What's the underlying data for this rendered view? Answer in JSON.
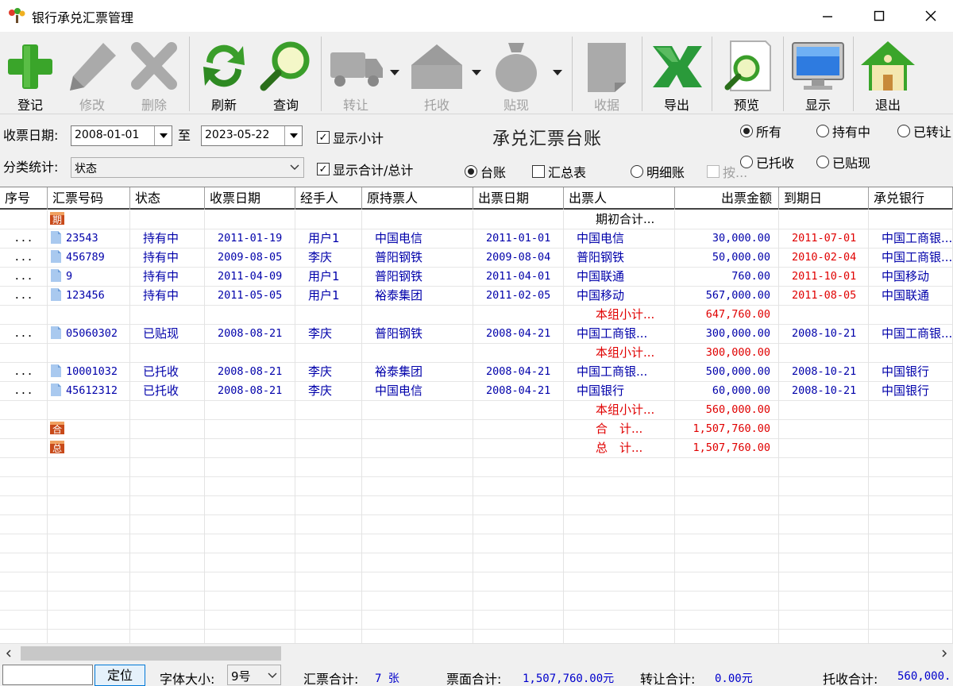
{
  "window": {
    "title": "银行承兑汇票管理"
  },
  "toolbar": {
    "items": [
      {
        "label": "登记",
        "icon": "plus-icon"
      },
      {
        "label": "修改",
        "icon": "pencil-icon"
      },
      {
        "label": "删除",
        "icon": "x-delete-icon"
      },
      {
        "label": "刷新",
        "icon": "refresh-icon"
      },
      {
        "label": "查询",
        "icon": "magnifier-icon"
      },
      {
        "label": "转让",
        "icon": "truck-icon"
      },
      {
        "label": "托收",
        "icon": "house-icon"
      },
      {
        "label": "贴现",
        "icon": "money-bag-icon"
      },
      {
        "label": "收据",
        "icon": "receipt-icon"
      },
      {
        "label": "导出",
        "icon": "excel-icon"
      },
      {
        "label": "预览",
        "icon": "preview-icon"
      },
      {
        "label": "显示",
        "icon": "monitor-icon"
      },
      {
        "label": "退出",
        "icon": "home-exit-icon"
      }
    ]
  },
  "filters": {
    "date_label": "收票日期:",
    "date_from": "2008-01-01",
    "date_to_label": "至",
    "date_to": "2023-05-22",
    "category_label": "分类统计:",
    "category_value": "状态",
    "show_subtotal": "显示小计",
    "show_total": "显示合计/总计",
    "report_title": "承兑汇票台账",
    "view_ledger": "台账",
    "view_summary": "汇总表",
    "view_detail": "明细账",
    "disabled_option": "按...",
    "status_all": "所有",
    "status_holding": "持有中",
    "status_transferred": "已转让",
    "status_collected": "已托收",
    "status_discounted": "已贴现"
  },
  "grid": {
    "columns": [
      "序号",
      "汇票号码",
      "状态",
      "收票日期",
      "经手人",
      "原持票人",
      "出票日期",
      "出票人",
      "出票金额",
      "到期日",
      "承兑银行"
    ],
    "opening_label": "期初合计...",
    "subtotal_label": "本组小计...",
    "total_label": "合　计...",
    "grand_label": "总　计...",
    "tag_opening": "期",
    "tag_total": "合",
    "tag_grand": "总",
    "rows": [
      {
        "kind": "opening"
      },
      {
        "kind": "data",
        "seq": "...",
        "no": "23543",
        "status": "持有中",
        "recv": "2011-01-19",
        "handler": "用户1",
        "holder": "中国电信",
        "issue": "2011-01-01",
        "drawer": "中国电信",
        "amount": "30,000.00",
        "due": "2011-07-01",
        "due_red": true,
        "bank": "中国工商银..."
      },
      {
        "kind": "data",
        "seq": "...",
        "no": "456789",
        "status": "持有中",
        "recv": "2009-08-05",
        "handler": "李庆",
        "holder": "普阳钢铁",
        "issue": "2009-08-04",
        "drawer": "普阳钢铁",
        "amount": "50,000.00",
        "due": "2010-02-04",
        "due_red": true,
        "bank": "中国工商银..."
      },
      {
        "kind": "data",
        "seq": "...",
        "no": "9",
        "status": "持有中",
        "recv": "2011-04-09",
        "handler": "用户1",
        "holder": "普阳钢铁",
        "issue": "2011-04-01",
        "drawer": "中国联通",
        "amount": "760.00",
        "due": "2011-10-01",
        "due_red": true,
        "bank": "中国移动"
      },
      {
        "kind": "data",
        "seq": "...",
        "no": "123456",
        "status": "持有中",
        "recv": "2011-05-05",
        "handler": "用户1",
        "holder": "裕泰集团",
        "issue": "2011-02-05",
        "drawer": "中国移动",
        "amount": "567,000.00",
        "due": "2011-08-05",
        "due_red": true,
        "bank": "中国联通"
      },
      {
        "kind": "subtotal",
        "amount": "647,760.00"
      },
      {
        "kind": "data",
        "seq": "...",
        "no": "05060302",
        "status": "已贴现",
        "recv": "2008-08-21",
        "handler": "李庆",
        "holder": "普阳钢铁",
        "issue": "2008-04-21",
        "drawer": "中国工商银...",
        "amount": "300,000.00",
        "due": "2008-10-21",
        "due_red": false,
        "bank": "中国工商银..."
      },
      {
        "kind": "subtotal",
        "amount": "300,000.00"
      },
      {
        "kind": "data",
        "seq": "...",
        "no": "10001032",
        "status": "已托收",
        "recv": "2008-08-21",
        "handler": "李庆",
        "holder": "裕泰集团",
        "issue": "2008-04-21",
        "drawer": "中国工商银...",
        "amount": "500,000.00",
        "due": "2008-10-21",
        "due_red": false,
        "bank": "中国银行"
      },
      {
        "kind": "data",
        "seq": "...",
        "no": "45612312",
        "status": "已托收",
        "recv": "2008-08-21",
        "handler": "李庆",
        "holder": "中国电信",
        "issue": "2008-04-21",
        "drawer": "中国银行",
        "amount": "60,000.00",
        "due": "2008-10-21",
        "due_red": false,
        "bank": "中国银行"
      },
      {
        "kind": "subtotal",
        "amount": "560,000.00"
      },
      {
        "kind": "total",
        "amount": "1,507,760.00"
      },
      {
        "kind": "grand",
        "amount": "1,507,760.00"
      }
    ]
  },
  "status": {
    "locate_input": "",
    "locate_btn": "定位",
    "font_label": "字体大小:",
    "font_value": "9号",
    "count_label": "汇票合计:",
    "count_value": "7 张",
    "face_label": "票面合计:",
    "face_value": "1,507,760.00元",
    "transfer_label": "转让合计:",
    "transfer_value": "0.00元",
    "collect_label": "托收合计:",
    "collect_value": "560,000."
  },
  "colors": {
    "blue_text": "#0000aa",
    "red_text": "#e00000",
    "green_icon": "#3aa52a",
    "gray_disabled": "#a8a8a8"
  }
}
